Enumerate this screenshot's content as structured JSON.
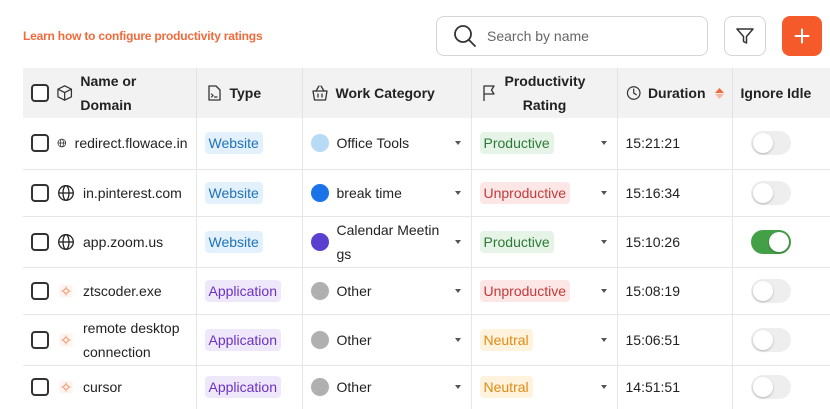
{
  "header": {
    "learn_link": "Learn how to configure productivity ratings",
    "search_placeholder": "Search by name",
    "accent_color": "#f55b2a"
  },
  "table": {
    "columns": {
      "name": "Name or Domain",
      "type": "Type",
      "work_category": "Work Category",
      "productivity": "Productivity Rating",
      "duration": "Duration",
      "ignore_idle": "Ignore Idle"
    },
    "rows": [
      {
        "icon": "globe-icon",
        "name": "redirect.flowace.in",
        "type": "Website",
        "category": "Office Tools",
        "category_color": "#b7daf5",
        "rating": "Productive",
        "duration": "15:21:21",
        "ignore_idle": false
      },
      {
        "icon": "globe-icon",
        "name": "in.pinterest.com",
        "type": "Website",
        "category": "break time",
        "category_color": "#1a73e8",
        "rating": "Unproductive",
        "duration": "15:16:34",
        "ignore_idle": false
      },
      {
        "icon": "globe-icon",
        "name": "app.zoom.us",
        "type": "Website",
        "category": "Calendar Meetings",
        "category_color": "#5b3fd1",
        "rating": "Productive",
        "duration": "15:10:26",
        "ignore_idle": true
      },
      {
        "icon": "app-icon",
        "name": "ztscoder.exe",
        "type": "Application",
        "category": "Other",
        "category_color": "#b0b0b0",
        "rating": "Unproductive",
        "duration": "15:08:19",
        "ignore_idle": false
      },
      {
        "icon": "app-icon",
        "name": "remote desktop connection",
        "type": "Application",
        "category": "Other",
        "category_color": "#b0b0b0",
        "rating": "Neutral",
        "duration": "15:06:51",
        "ignore_idle": false
      },
      {
        "icon": "app-icon",
        "name": "cursor",
        "type": "Application",
        "category": "Other",
        "category_color": "#b0b0b0",
        "rating": "Neutral",
        "duration": "14:51:51",
        "ignore_idle": false
      }
    ]
  }
}
